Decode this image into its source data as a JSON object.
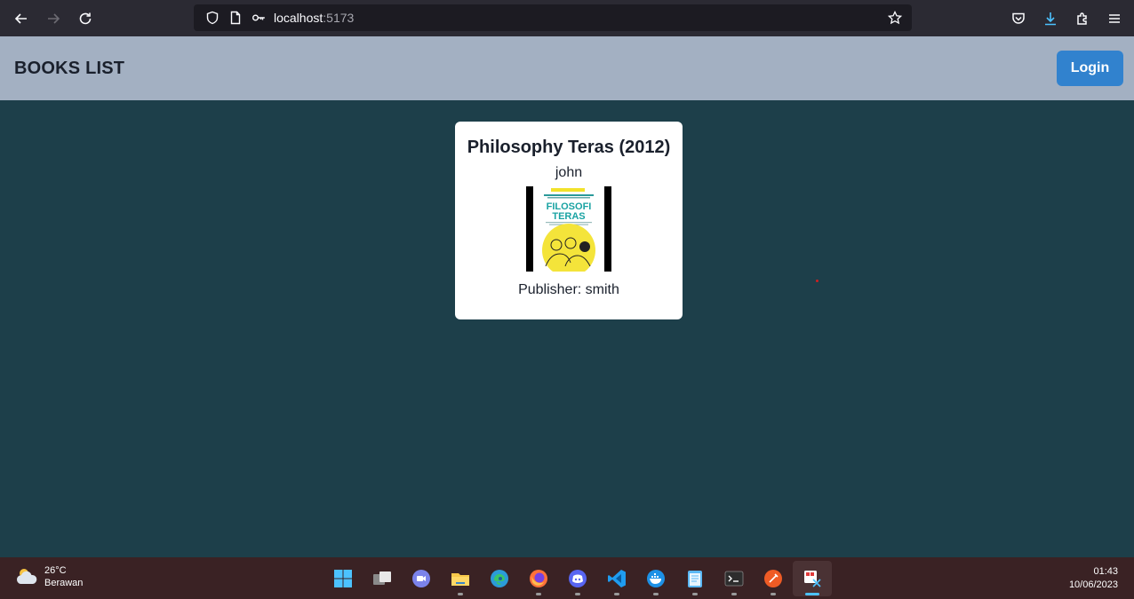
{
  "browser": {
    "url_host": "localhost",
    "url_port": ":5173"
  },
  "header": {
    "title": "BOOKS LIST",
    "login_label": "Login"
  },
  "book": {
    "title": "Philosophy Teras (2012)",
    "author": "john",
    "cover_text": "FILOSOFI TERAS",
    "publisher": "Publisher: smith"
  },
  "taskbar": {
    "weather_temp": "26°C",
    "weather_desc": "Berawan",
    "time": "01:43",
    "date": "10/06/2023",
    "apps": [
      "windows-start",
      "task-view",
      "teams-chat",
      "file-explorer",
      "edge",
      "firefox",
      "discord",
      "vscode",
      "docker",
      "notepad",
      "terminal",
      "postman",
      "snipping-tool"
    ]
  },
  "colors": {
    "header_bg": "#a3b0c2",
    "main_bg": "#1d3f4a",
    "login_bg": "#3182ce"
  }
}
